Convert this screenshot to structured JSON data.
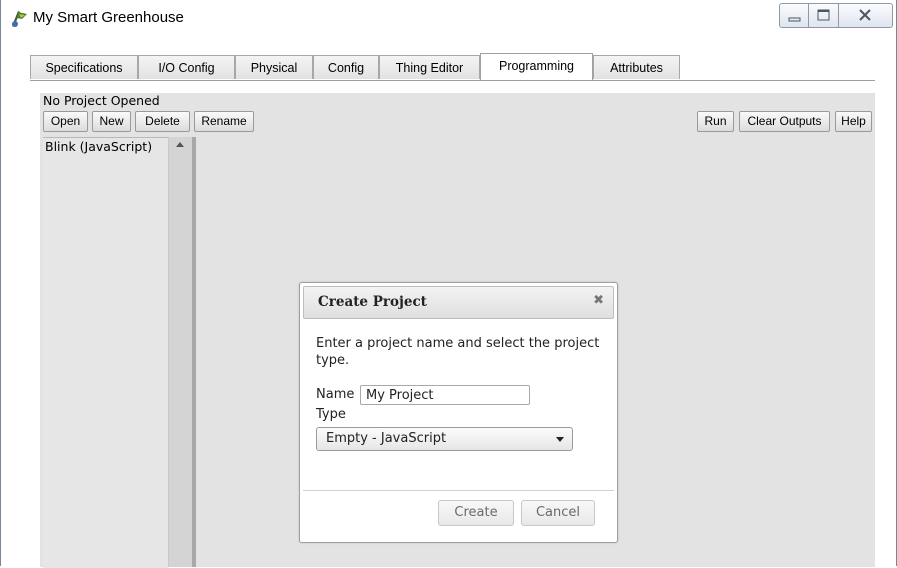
{
  "window": {
    "title": "My Smart Greenhouse",
    "controls": [
      "minimize-icon",
      "maximize-icon",
      "close-icon"
    ]
  },
  "tabs": [
    {
      "label": "Specifications",
      "active": false
    },
    {
      "label": "I/O Config",
      "active": false
    },
    {
      "label": "Physical",
      "active": false
    },
    {
      "label": "Config",
      "active": false
    },
    {
      "label": "Thing Editor",
      "active": false
    },
    {
      "label": "Programming",
      "active": true
    },
    {
      "label": "Attributes",
      "active": false
    }
  ],
  "programming": {
    "status": "No Project Opened",
    "buttons": {
      "open": "Open",
      "new": "New",
      "delete": "Delete",
      "rename": "Rename",
      "run": "Run",
      "clear_outputs": "Clear Outputs",
      "help": "Help"
    },
    "projects": [
      "Blink (JavaScript)"
    ]
  },
  "dialog": {
    "title": "Create Project",
    "close_icon": "close-icon",
    "description": "Enter a project name and select the project type.",
    "name_label": "Name",
    "name_value": "My Project",
    "type_label": "Type",
    "type_value": "Empty - JavaScript",
    "create_label": "Create",
    "cancel_label": "Cancel"
  },
  "colors": {
    "panel_background": "#e3e3e3",
    "disabled_text": "#6a6a6a"
  }
}
